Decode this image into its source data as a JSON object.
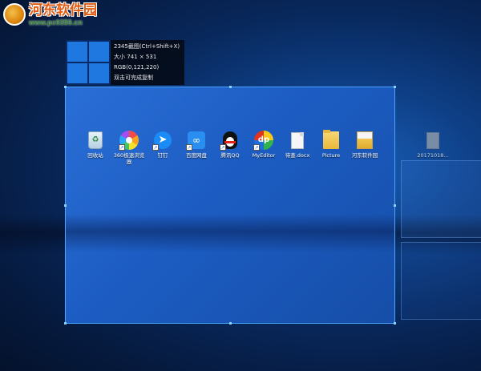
{
  "watermark": {
    "title": "河东软件园",
    "url": "www.pc0359.cn"
  },
  "capture_info": {
    "title_line": "2345截图(Ctrl+Shift+X)",
    "size_label": "大小",
    "size_value": "741 × 531",
    "rgb_label": "RGB",
    "rgb_value": "(0,121,220)",
    "hint": "双击可完成复制"
  },
  "desktop_icons": [
    {
      "label": "回收站",
      "icon": "recycle-bin-icon",
      "shortcut": false
    },
    {
      "label": "360极速浏览器",
      "icon": "browser-360-icon",
      "shortcut": true
    },
    {
      "label": "钉钉",
      "icon": "dingtalk-icon",
      "shortcut": true
    },
    {
      "label": "百度网盘",
      "icon": "baidu-netdisk-icon",
      "shortcut": true
    },
    {
      "label": "腾讯QQ",
      "icon": "qq-penguin-icon",
      "shortcut": true
    },
    {
      "label": "MyEditor",
      "icon": "myeditor-icon",
      "shortcut": true
    },
    {
      "label": "待查.docx",
      "icon": "document-icon",
      "shortcut": false
    },
    {
      "label": "Picture",
      "icon": "folder-icon",
      "shortcut": false
    },
    {
      "label": "河东软件园",
      "icon": "folder-with-files-icon",
      "shortcut": false
    },
    {
      "label": "20171018...",
      "icon": "grey-file-icon",
      "shortcut": false
    }
  ],
  "colors": {
    "selection_border": "#4aa3ff",
    "accent_blue": "#0079dc",
    "watermark_orange": "#e25b12"
  }
}
